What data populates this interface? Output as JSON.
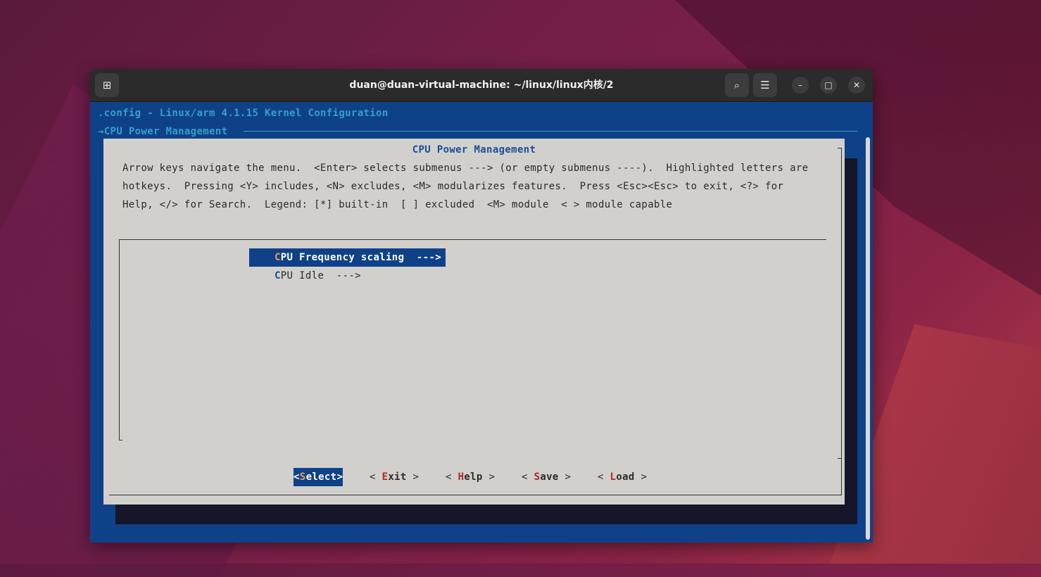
{
  "window": {
    "title": "duan@duan-virtual-machine: ~/linux/linux内核/2",
    "new_tab_icon": "⊞",
    "search_icon": "⌕",
    "menu_icon": "☰",
    "minimize_icon": "–",
    "maximize_icon": "□",
    "close_icon": "✕"
  },
  "terminal": {
    "config_title": ".config - Linux/arm 4.1.15 Kernel Configuration",
    "breadcrumb": "→CPU Power Management",
    "dialog": {
      "title": "CPU Power Management",
      "help_lines": [
        "Arrow keys navigate the menu.  <Enter> selects submenus ---> (or empty submenus ----).  Highlighted letters are",
        "hotkeys.  Pressing <Y> includes, <N> excludes, <M> modularizes features.  Press <Esc><Esc> to exit, <?> for",
        "Help, </> for Search.  Legend: [*] built-in  [ ] excluded  <M> module  < > module capable"
      ],
      "menu_items": [
        {
          "hotkey": "C",
          "label": "PU Frequency scaling  --->",
          "selected": true
        },
        {
          "hotkey": "C",
          "label": "PU Idle  --->",
          "selected": false
        }
      ],
      "buttons": [
        {
          "open": "<",
          "key": "S",
          "rest": "elect",
          "close": ">",
          "active": true
        },
        {
          "open": "< ",
          "key": "E",
          "rest": "xit",
          "close": " >",
          "active": false
        },
        {
          "open": "< ",
          "key": "H",
          "rest": "elp",
          "close": " >",
          "active": false
        },
        {
          "open": "< ",
          "key": "S",
          "rest": "ave",
          "close": " >",
          "active": false
        },
        {
          "open": "< ",
          "key": "L",
          "rest": "oad",
          "close": " >",
          "active": false
        }
      ]
    }
  },
  "colors": {
    "terminal_bg": "#0f4189",
    "dialog_bg": "#d2d0cc",
    "title_cyan": "#36a0c6",
    "hotkey_red": "#b0262a"
  }
}
